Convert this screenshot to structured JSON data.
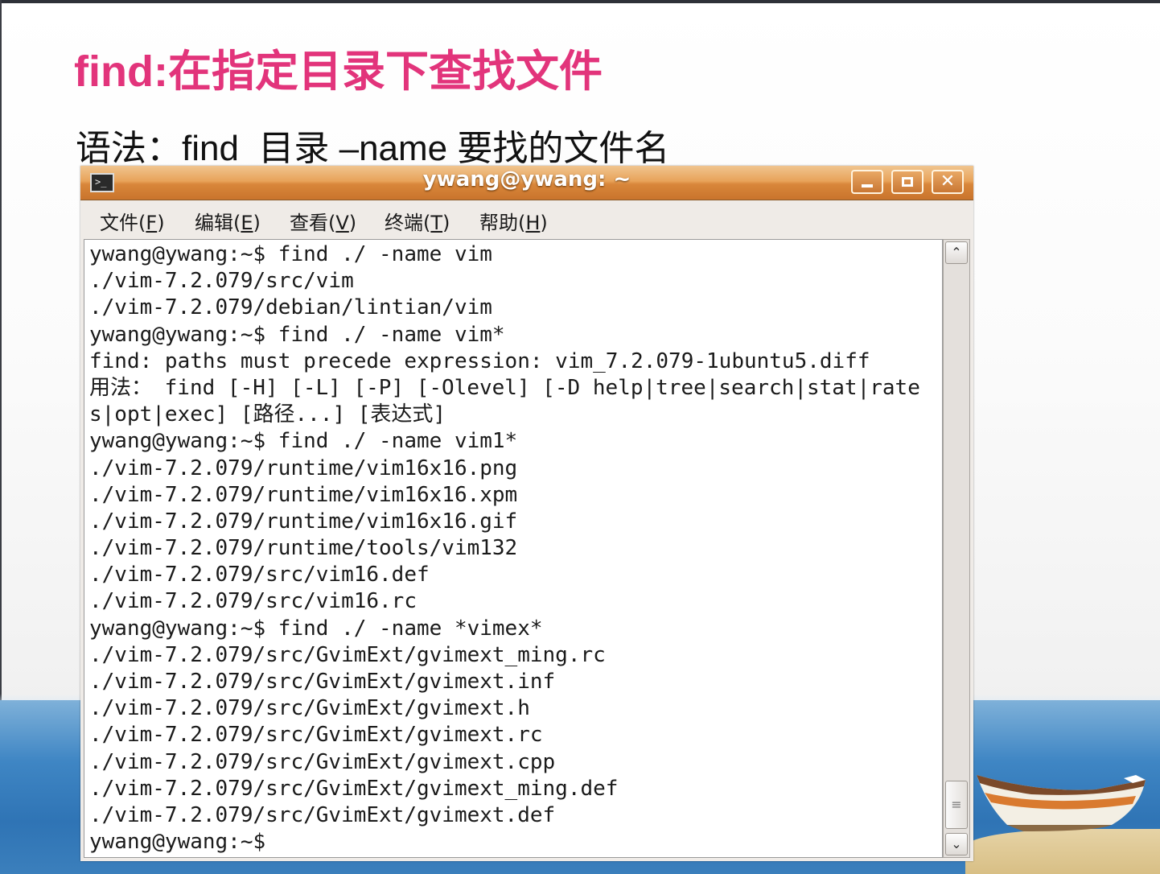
{
  "slide": {
    "title": "find:在指定目录下查找文件",
    "syntax": "语法：find  目录 –name 要找的文件名"
  },
  "window": {
    "title": "ywang@ywang: ~",
    "terminal_icon": "terminal-icon",
    "controls": {
      "minimize": "minimize-icon",
      "maximize": "maximize-icon",
      "close": "close-icon"
    }
  },
  "menu": [
    {
      "label": "文件(",
      "key": "F",
      "suffix": ")"
    },
    {
      "label": "编辑(",
      "key": "E",
      "suffix": ")"
    },
    {
      "label": "查看(",
      "key": "V",
      "suffix": ")"
    },
    {
      "label": "终端(",
      "key": "T",
      "suffix": ")"
    },
    {
      "label": "帮助(",
      "key": "H",
      "suffix": ")"
    }
  ],
  "terminal": {
    "lines": [
      "ywang@ywang:~$ find ./ -name vim",
      "./vim-7.2.079/src/vim",
      "./vim-7.2.079/debian/lintian/vim",
      "ywang@ywang:~$ find ./ -name vim*",
      "find: paths must precede expression: vim_7.2.079-1ubuntu5.diff",
      "用法： find [-H] [-L] [-P] [-Olevel] [-D help|tree|search|stat|rate",
      "s|opt|exec] [路径...] [表达式]",
      "ywang@ywang:~$ find ./ -name vim1*",
      "./vim-7.2.079/runtime/vim16x16.png",
      "./vim-7.2.079/runtime/vim16x16.xpm",
      "./vim-7.2.079/runtime/vim16x16.gif",
      "./vim-7.2.079/runtime/tools/vim132",
      "./vim-7.2.079/src/vim16.def",
      "./vim-7.2.079/src/vim16.rc",
      "ywang@ywang:~$ find ./ -name *vimex*",
      "./vim-7.2.079/src/GvimExt/gvimext_ming.rc",
      "./vim-7.2.079/src/GvimExt/gvimext.inf",
      "./vim-7.2.079/src/GvimExt/gvimext.h",
      "./vim-7.2.079/src/GvimExt/gvimext.rc",
      "./vim-7.2.079/src/GvimExt/gvimext.cpp",
      "./vim-7.2.079/src/GvimExt/gvimext_ming.def",
      "./vim-7.2.079/src/GvimExt/gvimext.def",
      "ywang@ywang:~$"
    ]
  },
  "scrollbar": {
    "up_icon": "arrow-up-icon",
    "down_icon": "arrow-down-icon",
    "position": 1.0
  }
}
